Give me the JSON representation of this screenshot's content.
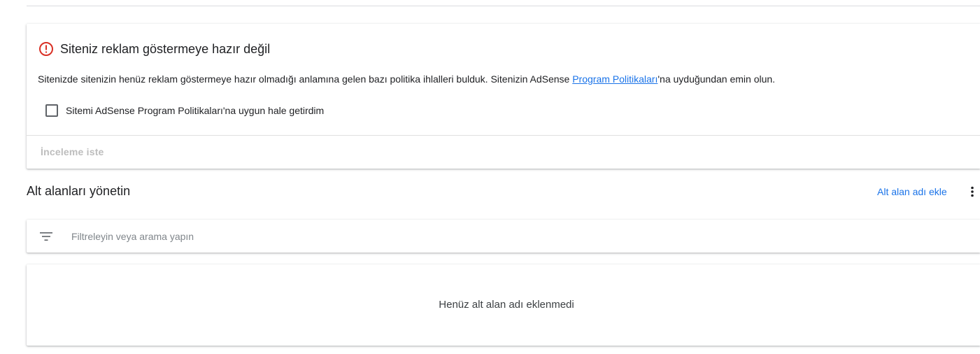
{
  "alert": {
    "title": "Siteniz reklam göstermeye hazır değil",
    "description_before": "Sitenizde sitenizin henüz reklam göstermeye hazır olmadığı anlamına gelen bazı politika ihlalleri bulduk. Sitenizin AdSense ",
    "description_link": "Program Politikaları",
    "description_after": "'na uyduğundan emin olun.",
    "checkbox_label": "Sitemi AdSense Program Politikaları'na uygun hale getirdim",
    "checkbox_checked": false,
    "review_button": "İnceleme iste",
    "icon": "error-outline-icon",
    "icon_color": "#d93025"
  },
  "subdomains": {
    "title": "Alt alanları yönetin",
    "add_button": "Alt alan adı ekle",
    "more_icon": "more-vert-icon",
    "filter_icon": "filter-list-icon",
    "filter_placeholder": "Filtreleyin veya arama yapın",
    "empty_message": "Henüz alt alan adı eklenmedi"
  },
  "colors": {
    "accent": "#1a73e8",
    "error": "#d93025",
    "disabled_text": "#bdbdbd"
  }
}
